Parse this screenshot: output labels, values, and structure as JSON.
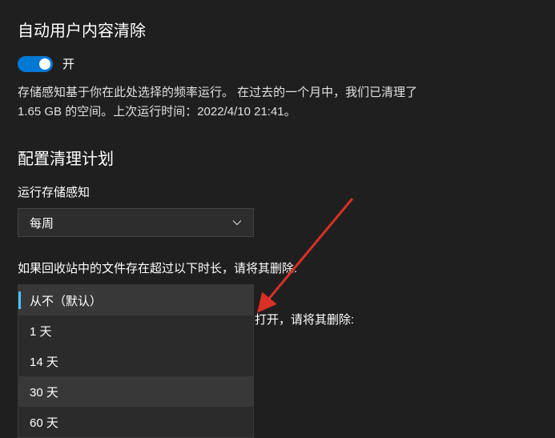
{
  "title": "自动用户内容清除",
  "toggle": {
    "state": "开"
  },
  "description": "存储感知基于你在此处选择的频率运行。 在过去的一个月中，我们已清理了 1.65 GB 的空间。上次运行时间：2022/4/10 21:41。",
  "schedule_title": "配置清理计划",
  "run_label": "运行存储感知",
  "run_select": {
    "value": "每周"
  },
  "recycle_label": "如果回收站中的文件存在超过以下时长，请将其删除:",
  "recycle_dropdown": {
    "options": [
      "从不（默认）",
      "1 天",
      "14 天",
      "30 天",
      "60 天"
    ],
    "selected_index": 0,
    "hover_index": 3
  },
  "behind_text": "打开，请将其删除:"
}
